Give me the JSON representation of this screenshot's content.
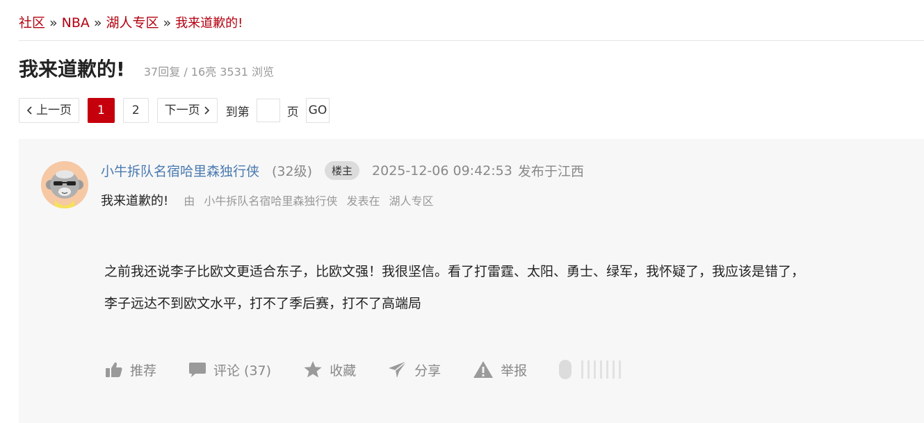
{
  "breadcrumb": {
    "items": [
      "社区",
      "NBA",
      "湖人专区"
    ],
    "separator": "»",
    "current": "我来道歉的!"
  },
  "thread": {
    "title": "我来道歉的!",
    "stats": "37回复 / 16亮 3531 浏览"
  },
  "pagination": {
    "prev": "上一页",
    "pages": [
      "1",
      "2"
    ],
    "current_page": "1",
    "next": "下一页",
    "goto_prefix": "到第",
    "goto_suffix": "页",
    "go": "GO"
  },
  "post": {
    "author": "小牛拆队名宿哈里森独行侠",
    "level": "(32级)",
    "badge": "楼主",
    "time": "2025-12-06 09:42:53",
    "location": "发布于江西",
    "subtitle": "我来道歉的!",
    "by_label": "由",
    "by_author": "小牛拆队名宿哈里森独行侠",
    "posted_in": "发表在",
    "board": "湖人专区",
    "content_lines": [
      "之前我还说李子比欧文更适合东子，比欧文强！我很坚信。看了打雷霆、太阳、勇士、绿军，我怀疑了，我应该是错了，",
      "李子远达不到欧文水平，打不了季后赛，打不了高端局"
    ]
  },
  "actions": {
    "recommend": "推荐",
    "comment": "评论 (37)",
    "favorite": "收藏",
    "share": "分享",
    "report": "举报"
  },
  "colors": {
    "accent": "#c5000c",
    "link": "#b3000f",
    "author": "#4a7ab0",
    "panel": "#f7f7f7"
  },
  "icons": [
    "thumb-up-icon",
    "comment-icon",
    "star-icon",
    "share-icon",
    "warning-icon",
    "chevron-left-icon",
    "chevron-right-icon"
  ]
}
